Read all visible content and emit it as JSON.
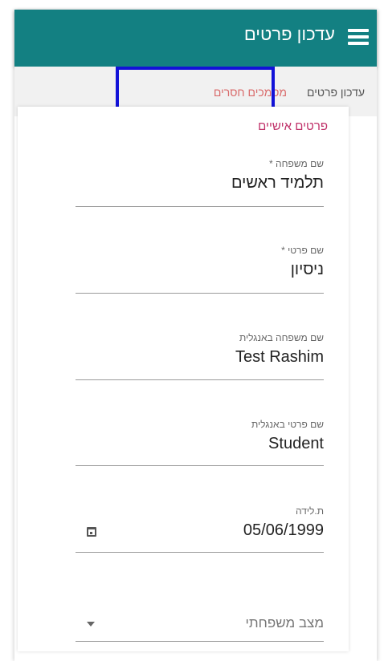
{
  "header": {
    "title": "עדכון פרטים"
  },
  "tabs": [
    {
      "label": "עדכון פרטים"
    },
    {
      "label": "מסמכים חסרים"
    }
  ],
  "section": {
    "title": "פרטים אישיים"
  },
  "fields": {
    "last_name": {
      "label": "שם משפחה *",
      "value": "תלמיד ראשים"
    },
    "first_name": {
      "label": "שם פרטי *",
      "value": "ניסיון"
    },
    "last_name_en": {
      "label": "שם משפחה באנגלית",
      "value": "Test Rashim"
    },
    "first_name_en": {
      "label": "שם פרטי באנגלית",
      "value": "Student"
    },
    "birth_date": {
      "label": "ת.לידה",
      "value": "05/06/1999"
    },
    "marital_status": {
      "placeholder": "מצב משפחתי"
    }
  },
  "colors": {
    "appbar": "#138082",
    "accent_pink": "#c0326a",
    "tab_active": "#d96a6a",
    "highlight_box": "#1212d8"
  }
}
